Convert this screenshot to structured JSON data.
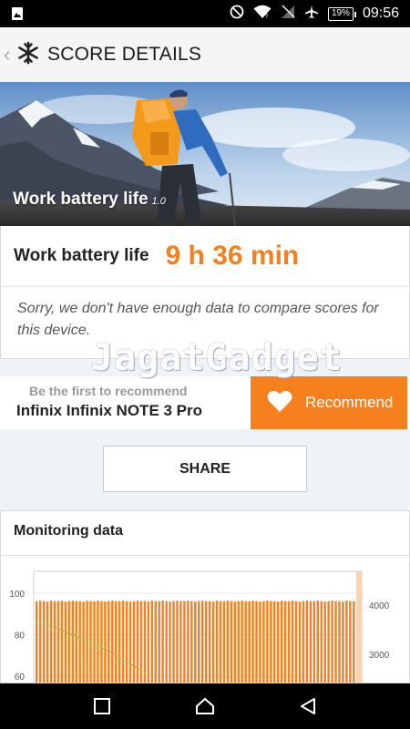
{
  "status_bar": {
    "time": "09:56",
    "battery": "19%"
  },
  "header": {
    "title": "SCORE DETAILS"
  },
  "hero": {
    "title": "Work battery life",
    "version": "1.0"
  },
  "score": {
    "label": "Work battery life",
    "value": "9 h 36 min"
  },
  "compare": {
    "message": "Sorry, we don't have enough data to compare scores for this device."
  },
  "watermark": "JagatGadget",
  "recommend": {
    "prompt": "Be the first to recommend",
    "device": "Infinix Infinix NOTE 3 Pro",
    "button_label": "Recommend"
  },
  "share": {
    "label": "SHARE"
  },
  "monitoring": {
    "title": "Monitoring data",
    "left_axis_ticks": [
      "100",
      "80",
      "60"
    ],
    "right_axis_ticks": [
      "4000",
      "3000"
    ],
    "colors": {
      "bars": "#f7801e",
      "line": "#8bc34a"
    }
  },
  "chart_data": {
    "type": "bar",
    "left_axis": {
      "ticks": [
        100,
        80,
        60
      ]
    },
    "right_axis": {
      "ticks": [
        4000,
        3000
      ]
    },
    "series": [
      {
        "type": "bar",
        "axis": "right",
        "values": [
          4080,
          4090,
          4080,
          4070,
          4090,
          4080,
          4080,
          4090,
          4070,
          4080,
          4090,
          4080,
          4080,
          4070,
          4090,
          4080,
          4080,
          4090,
          4080,
          4070,
          4080,
          4090,
          4080,
          4080,
          4090,
          4080,
          4070,
          4080,
          4090,
          4080,
          4080,
          4070,
          4090,
          4080,
          4080,
          4090,
          4080,
          4070,
          4080,
          4090,
          4080,
          4080,
          4090,
          4080,
          4070,
          4080,
          4090,
          4080,
          4080,
          4070,
          4090,
          4080,
          4080,
          4090,
          4080,
          4070,
          4080,
          4090,
          4080,
          4080,
          4090,
          4080,
          4070,
          4080,
          4090,
          4080,
          4080,
          4070,
          4090,
          4080,
          4080,
          4090,
          4080,
          4070,
          4080,
          4090,
          4080,
          4080,
          4090,
          4080,
          4070,
          4080,
          4090,
          4080,
          4080,
          4070,
          4090,
          4080,
          4080,
          4090
        ]
      },
      {
        "type": "line",
        "axis": "left",
        "x": [
          0,
          1,
          2,
          3
        ],
        "values": [
          87,
          80,
          72,
          61
        ]
      }
    ]
  }
}
